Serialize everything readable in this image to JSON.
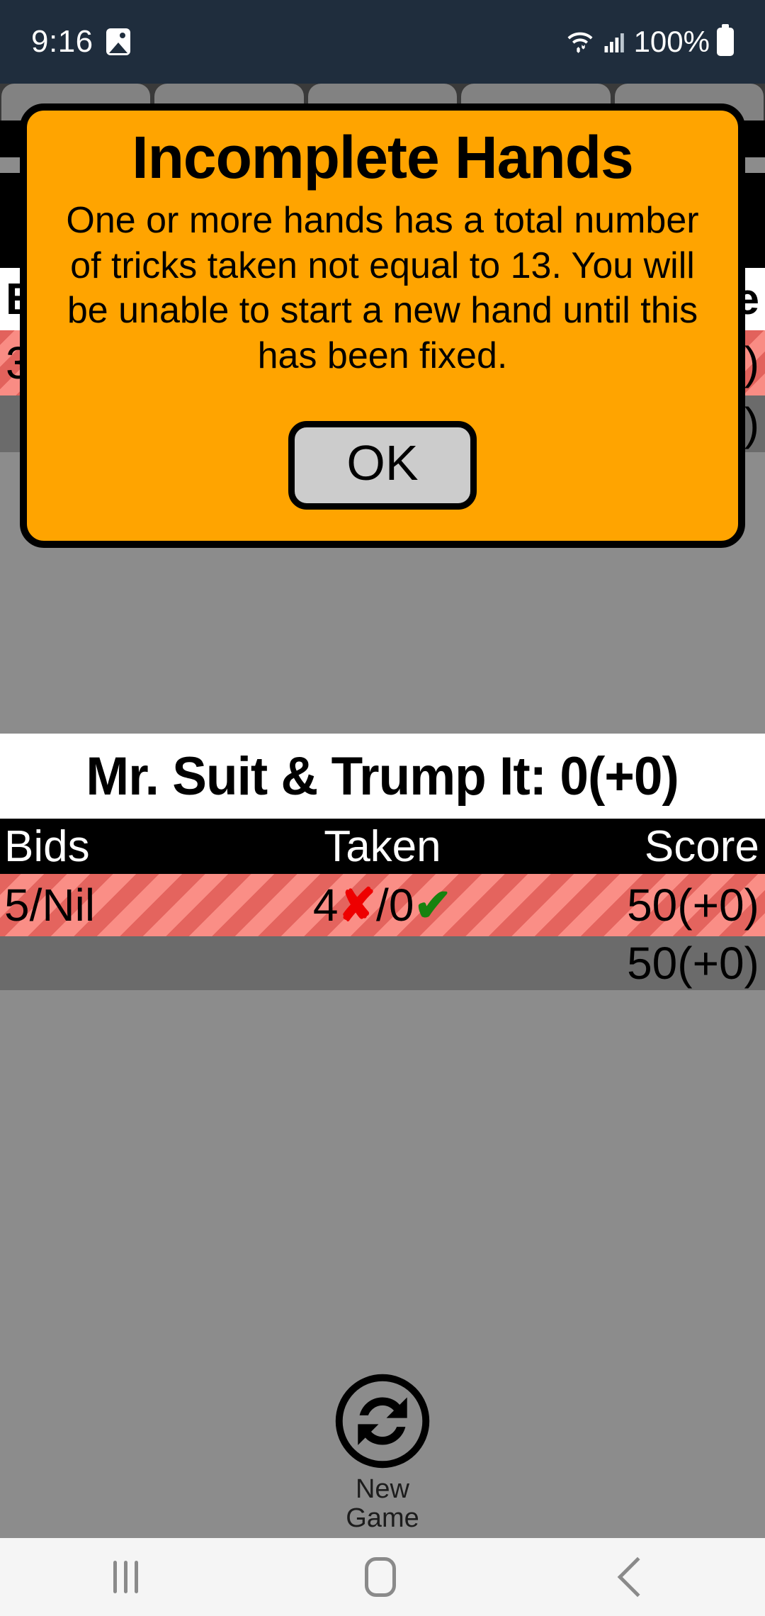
{
  "status_bar": {
    "time": "9:16",
    "gallery_icon": "gallery-icon",
    "wifi_icon": "wifi-icon",
    "signal_icon": "signal-bars-icon",
    "battery_percent": "100%",
    "battery_icon": "battery-full-icon",
    "background_color": "#1f2d3d"
  },
  "dialog": {
    "title": "Incomplete Hands",
    "message": "One or more hands has a total number of tricks taken not equal to 13. You will be unable to start a new hand until this has been fixed.",
    "ok_label": "OK",
    "background_color": "#ffa400",
    "border_color": "#000000",
    "button_color": "#cccccc"
  },
  "background_app": {
    "tab_count": 5,
    "obscured_header": {
      "bids": "B",
      "score": "e"
    },
    "obscured_striped_row": {
      "bids": "3",
      "score": "0)"
    },
    "obscured_gray_row": {
      "score": "0)"
    }
  },
  "scorecard": {
    "title": "Mr. Suit & Trump It: 0(+0)",
    "columns": [
      "Bids",
      "Taken",
      "Score"
    ],
    "rows": [
      {
        "style": "striped",
        "bids": "5/Nil",
        "taken_first": "4",
        "taken_first_mark": "✘",
        "taken_separator": "/",
        "taken_second": "0",
        "taken_second_mark": "✔",
        "score": "50(+0)"
      },
      {
        "style": "gray",
        "bids": "",
        "taken": "",
        "score": "50(+0)"
      }
    ],
    "colors": {
      "header_bg": "#000000",
      "header_text": "#ffffff",
      "stripe_light": "#fa8e86",
      "stripe_dark": "#e4645e",
      "gray_row": "#6b6b6b",
      "x_mark": "#ee0000",
      "check_mark": "#17820f"
    }
  },
  "new_game": {
    "icon": "refresh-circle-icon",
    "label_line1": "New",
    "label_line2": "Game"
  },
  "nav_bar": {
    "recents_icon": "recents-icon",
    "home_icon": "home-icon",
    "back_icon": "back-icon",
    "background_color": "#f5f5f5"
  }
}
